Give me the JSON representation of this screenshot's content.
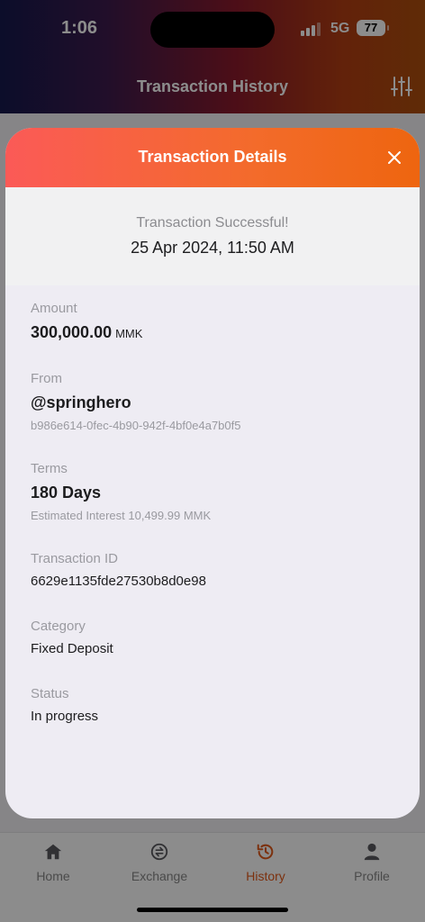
{
  "status_bar": {
    "time": "1:06",
    "network": "5G",
    "battery": "77"
  },
  "header": {
    "title": "Transaction History",
    "filter_icon": "sliders-icon"
  },
  "tabs": [
    {
      "label": "Home",
      "icon": "home-icon",
      "active": false
    },
    {
      "label": "Exchange",
      "icon": "exchange-icon",
      "active": false
    },
    {
      "label": "History",
      "icon": "history-icon",
      "active": true
    },
    {
      "label": "Profile",
      "icon": "profile-icon",
      "active": false
    }
  ],
  "modal": {
    "title": "Transaction Details",
    "close_icon": "close-icon",
    "status_text": "Transaction Successful!",
    "datetime": "25 Apr 2024, 11:50 AM",
    "amount": {
      "label": "Amount",
      "value": "300,000.00",
      "unit": "MMK"
    },
    "from": {
      "label": "From",
      "value": "@springhero",
      "sub": "b986e614-0fec-4b90-942f-4bf0e4a7b0f5"
    },
    "terms": {
      "label": "Terms",
      "value": "180 Days",
      "sub": "Estimated Interest 10,499.99 MMK"
    },
    "transaction_id": {
      "label": "Transaction ID",
      "value": "6629e1135fde27530b8d0e98"
    },
    "category": {
      "label": "Category",
      "value": "Fixed Deposit"
    },
    "status": {
      "label": "Status",
      "value": "In progress"
    }
  },
  "colors": {
    "accent": "#E2591A",
    "modal_header_start": "#FB5A57",
    "modal_header_end": "#EE650F"
  }
}
